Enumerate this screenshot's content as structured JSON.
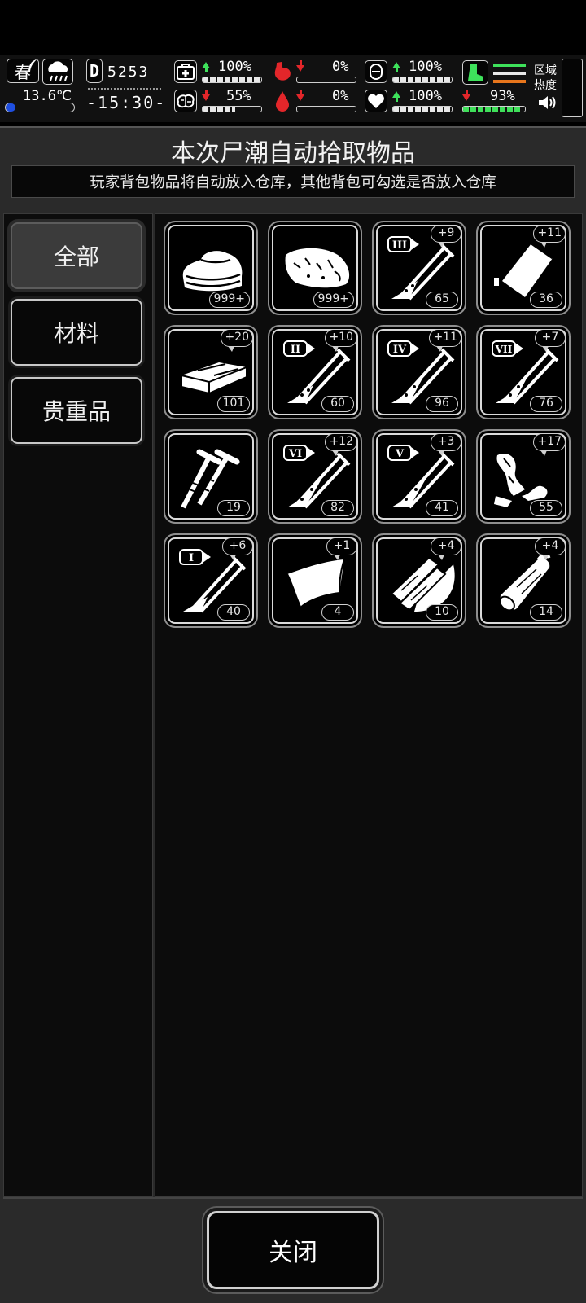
{
  "status": {
    "season": "春",
    "temperature": "13.6℃",
    "day_label": "D",
    "day": "5253",
    "time": "-15:30-",
    "health": "100%",
    "hunger": "0%",
    "shield": "100%",
    "mental": "55%",
    "thirst": "0%",
    "heart": "100%",
    "stamina": "93%",
    "zone_label": "区域热度",
    "progress": {
      "health": 1.0,
      "hunger": 0.0,
      "shield": 1.0,
      "mental": 0.55,
      "thirst": 0.0,
      "heart": 1.0,
      "stamina": 0.93
    },
    "colors": {
      "up": "#3ee25b",
      "down": "#e3262a",
      "boot": "#3ee25b"
    }
  },
  "dialog": {
    "title": "本次尸潮自动拾取物品",
    "subtitle": "玩家背包物品将自动放入仓库，其他背包可勾选是否放入仓库"
  },
  "categories": [
    {
      "label": "全部",
      "active": true
    },
    {
      "label": "材料",
      "active": false
    },
    {
      "label": "贵重品",
      "active": false
    }
  ],
  "items": [
    {
      "icon": "cloth-icon",
      "count": "999+",
      "bonus": ""
    },
    {
      "icon": "raw-meat-icon",
      "count": "999+",
      "bonus": ""
    },
    {
      "icon": "test-tube-icon",
      "tier": "III",
      "count": "65",
      "bonus": "+9"
    },
    {
      "icon": "plastic-bag-icon",
      "count": "36",
      "bonus": "+11"
    },
    {
      "icon": "bar-block-icon",
      "count": "101",
      "bonus": "+20"
    },
    {
      "icon": "test-tube-icon",
      "tier": "II",
      "count": "60",
      "bonus": "+10"
    },
    {
      "icon": "test-tube-icon",
      "tier": "IV",
      "count": "96",
      "bonus": "+11"
    },
    {
      "icon": "test-tube-icon",
      "tier": "VII",
      "count": "76",
      "bonus": "+7"
    },
    {
      "icon": "screws-icon",
      "count": "19",
      "bonus": ""
    },
    {
      "icon": "test-tube-icon",
      "tier": "VI",
      "count": "82",
      "bonus": "+12"
    },
    {
      "icon": "test-tube-icon",
      "tier": "V",
      "count": "41",
      "bonus": "+3"
    },
    {
      "icon": "rags-icon",
      "count": "55",
      "bonus": "+17"
    },
    {
      "icon": "test-tube-icon",
      "tier": "I",
      "count": "40",
      "bonus": "+6"
    },
    {
      "icon": "leather-icon",
      "count": "4",
      "bonus": "+1"
    },
    {
      "icon": "wood-planks-icon",
      "count": "10",
      "bonus": "+4"
    },
    {
      "icon": "log-icon",
      "count": "14",
      "bonus": "+4"
    }
  ],
  "close_label": "关闭"
}
